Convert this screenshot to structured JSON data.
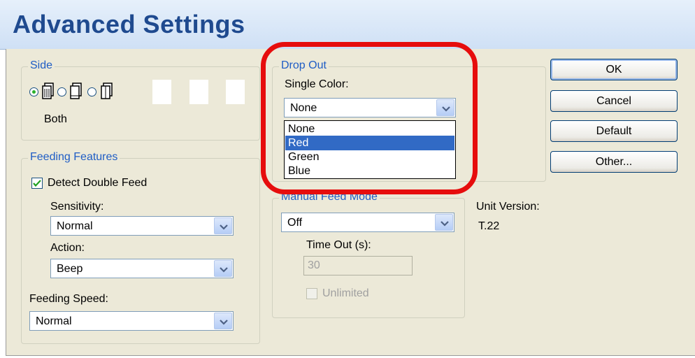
{
  "dialog": {
    "title": "Advanced Settings"
  },
  "side": {
    "group_label": "Side",
    "selected_caption": "Both",
    "options": [
      "both",
      "front",
      "back"
    ],
    "selected": "both"
  },
  "feeding": {
    "group_label": "Feeding Features",
    "detect_double_feed_label": "Detect Double Feed",
    "detect_double_feed_checked": true,
    "sensitivity_label": "Sensitivity:",
    "sensitivity_value": "Normal",
    "action_label": "Action:",
    "action_value": "Beep",
    "speed_label": "Feeding Speed:",
    "speed_value": "Normal"
  },
  "dropout": {
    "group_label": "Drop Out",
    "single_color_label": "Single Color:",
    "single_color_value": "None",
    "options": [
      "None",
      "Red",
      "Green",
      "Blue"
    ],
    "highlighted": "Red"
  },
  "manual_feed": {
    "group_label": "Manual Feed Mode",
    "mode_value": "Off",
    "timeout_label": "Time Out (s):",
    "timeout_value": "30",
    "unlimited_label": "Unlimited",
    "unlimited_checked": false
  },
  "unit": {
    "label": "Unit Version:",
    "value": "T.22"
  },
  "buttons": {
    "ok": "OK",
    "cancel": "Cancel",
    "default": "Default",
    "other": "Other..."
  },
  "colors": {
    "title_blue": "#1f4a8f",
    "group_label_blue": "#1f5dc5",
    "selection_blue": "#316ac5",
    "highlight_ring_red": "#e60d0d"
  }
}
